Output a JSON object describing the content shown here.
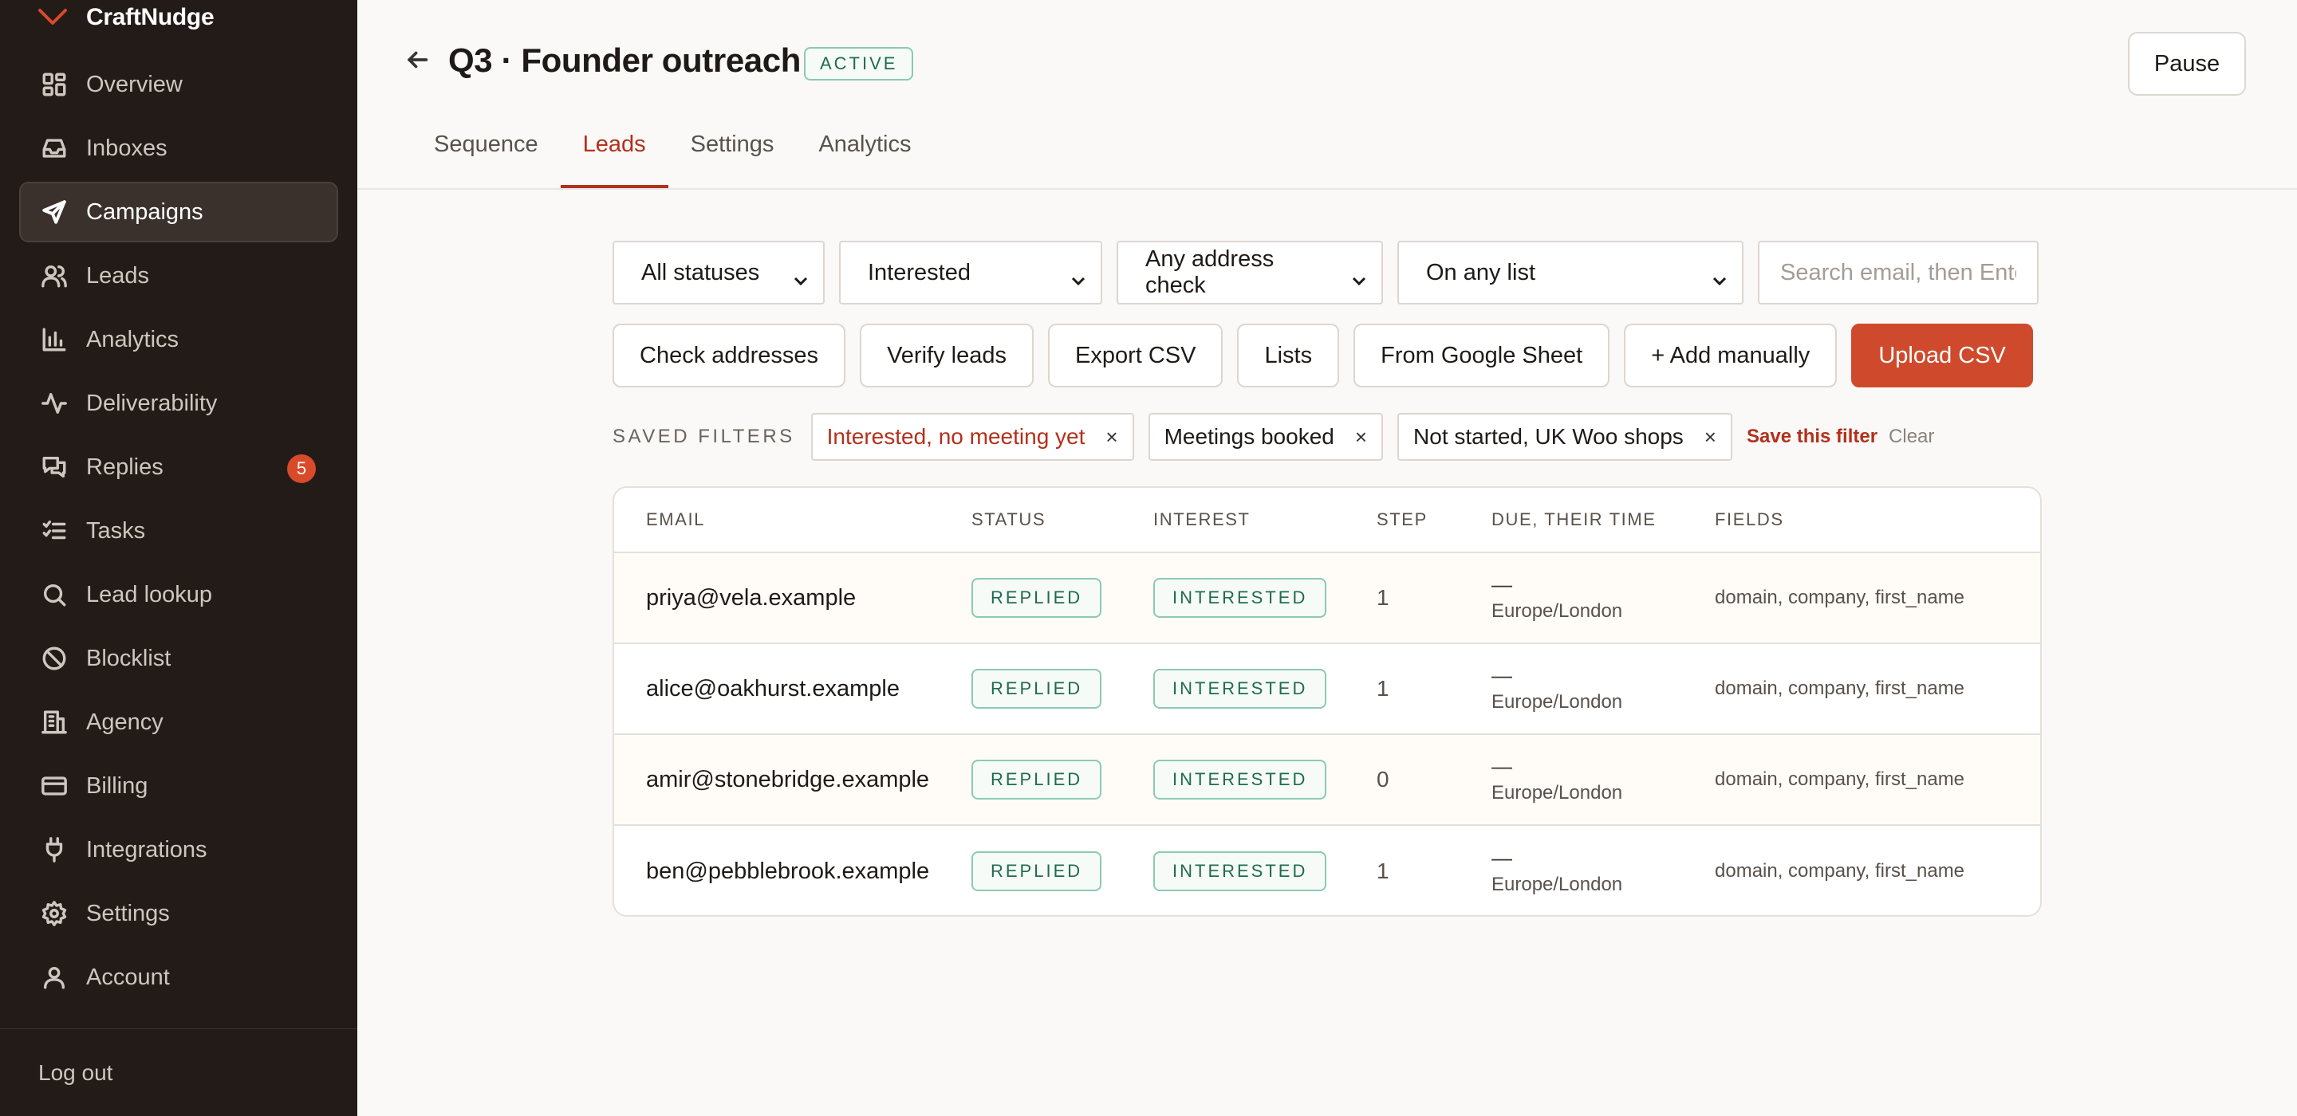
{
  "app": {
    "name": "CraftNudge"
  },
  "sidebar": {
    "items": [
      {
        "label": "Overview",
        "icon": "grid-icon",
        "active": false
      },
      {
        "label": "Inboxes",
        "icon": "inbox-icon",
        "active": false
      },
      {
        "label": "Campaigns",
        "icon": "send-icon",
        "active": true
      },
      {
        "label": "Leads",
        "icon": "users-icon",
        "active": false
      },
      {
        "label": "Analytics",
        "icon": "bar-chart-icon",
        "active": false
      },
      {
        "label": "Deliverability",
        "icon": "pulse-icon",
        "active": false
      },
      {
        "label": "Replies",
        "icon": "chat-icon",
        "active": false,
        "badge": "5"
      },
      {
        "label": "Tasks",
        "icon": "checklist-icon",
        "active": false
      },
      {
        "label": "Lead lookup",
        "icon": "search-icon",
        "active": false
      },
      {
        "label": "Blocklist",
        "icon": "ban-icon",
        "active": false
      },
      {
        "label": "Agency",
        "icon": "building-icon",
        "active": false
      },
      {
        "label": "Billing",
        "icon": "credit-card-icon",
        "active": false
      },
      {
        "label": "Integrations",
        "icon": "plug-icon",
        "active": false
      },
      {
        "label": "Settings",
        "icon": "gear-icon",
        "active": false
      },
      {
        "label": "Account",
        "icon": "user-icon",
        "active": false
      }
    ],
    "logout": "Log out"
  },
  "header": {
    "title": "Q3 · Founder outreach",
    "status": "ACTIVE",
    "pause_label": "Pause",
    "tabs": [
      {
        "label": "Sequence",
        "active": false
      },
      {
        "label": "Leads",
        "active": true
      },
      {
        "label": "Settings",
        "active": false
      },
      {
        "label": "Analytics",
        "active": false
      }
    ]
  },
  "filters": {
    "status": "All statuses",
    "interest": "Interested",
    "address_check": "Any address check",
    "list": "On any list",
    "search_placeholder": "Search email, then Enter"
  },
  "actions": {
    "check_addresses": "Check addresses",
    "verify_leads": "Verify leads",
    "export_csv": "Export CSV",
    "lists": "Lists",
    "from_google_sheet": "From Google Sheet",
    "add_manually": "+ Add manually",
    "upload_csv": "Upload CSV"
  },
  "saved_filters": {
    "label": "SAVED FILTERS",
    "chips": [
      {
        "label": "Interested, no meeting yet",
        "active": true
      },
      {
        "label": "Meetings booked",
        "active": false
      },
      {
        "label": "Not started, UK Woo shops",
        "active": false
      }
    ],
    "remove_glyph": "×",
    "save_label": "Save this filter",
    "clear_label": "Clear"
  },
  "table": {
    "columns": [
      "EMAIL",
      "STATUS",
      "INTEREST",
      "STEP",
      "DUE, THEIR TIME",
      "FIELDS"
    ],
    "rows": [
      {
        "email": "priya@vela.example",
        "status": "REPLIED",
        "interest": "INTERESTED",
        "step": "1",
        "due": "—",
        "tz": "Europe/London",
        "fields": "domain, company, first_name"
      },
      {
        "email": "alice@oakhurst.example",
        "status": "REPLIED",
        "interest": "INTERESTED",
        "step": "1",
        "due": "—",
        "tz": "Europe/London",
        "fields": "domain, company, first_name"
      },
      {
        "email": "amir@stonebridge.example",
        "status": "REPLIED",
        "interest": "INTERESTED",
        "step": "0",
        "due": "—",
        "tz": "Europe/London",
        "fields": "domain, company, first_name"
      },
      {
        "email": "ben@pebblebrook.example",
        "status": "REPLIED",
        "interest": "INTERESTED",
        "step": "1",
        "due": "—",
        "tz": "Europe/London",
        "fields": "domain, company, first_name"
      }
    ]
  },
  "colors": {
    "accent": "#cf4a2c",
    "accent_text": "#b3301b",
    "sidebar_bg": "#231b18",
    "success": "#1f6b52"
  }
}
